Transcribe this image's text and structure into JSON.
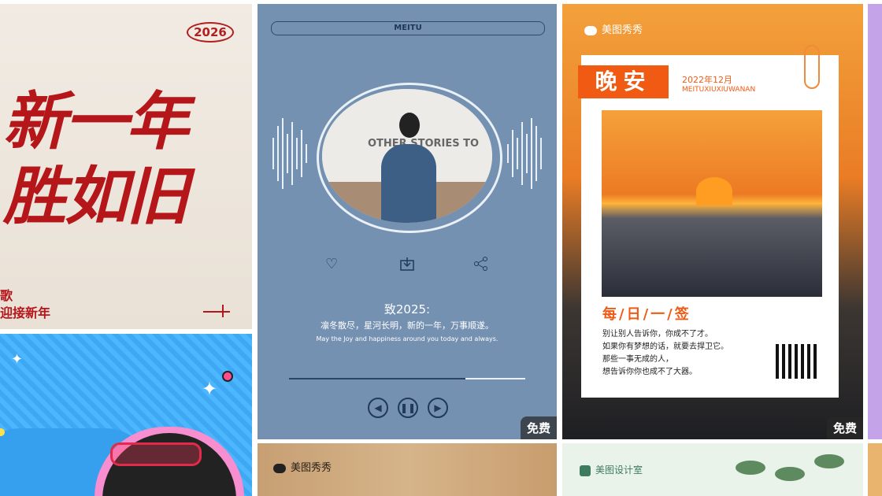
{
  "cards": {
    "newyear": {
      "year": "2026",
      "line1": "新一年",
      "line2": "胜如旧",
      "small1": "歌",
      "small2": "迎接新年"
    },
    "music": {
      "brand": "MEITU",
      "photo_text": "OTHER STORIES TO",
      "title": "致2025:",
      "subtitle": "凛冬散尽，星河长明，新的一年，万事顺遂。",
      "english": "May the Joy and happiness around you today and always.",
      "badge": "免费",
      "progress": 0.75
    },
    "goodnight": {
      "brand": "美图秀秀",
      "wan": "晚安",
      "date": "2022年12月",
      "pinyin": "MEITUXIUXIUWANAN",
      "daily": "每/日/一/签",
      "quote_lines": [
        "别让别人告诉你，你成不了才。",
        "如果你有梦想的话，就要去捍卫它。",
        "那些一事无成的人，",
        "想告诉你你也成不了大器。"
      ],
      "badge": "免费"
    },
    "bottom_mid": {
      "brand": "美图秀秀"
    },
    "bottom_right": {
      "brand": "美图设计室"
    }
  },
  "icons": {
    "heart": "heart-icon",
    "download": "download-icon",
    "share": "share-icon",
    "prev": "prev-icon",
    "pause": "pause-icon",
    "next": "next-icon"
  },
  "colors": {
    "newyear_red": "#b5161a",
    "music_blue": "#7591b2",
    "sunset_orange": "#f05a12"
  }
}
